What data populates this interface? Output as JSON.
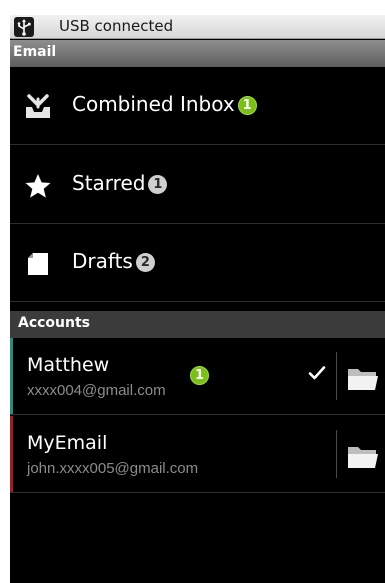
{
  "status_bar": {
    "notification_icon": "usb-icon",
    "text": "USB connected"
  },
  "title_bar": {
    "title": "Email"
  },
  "mailboxes": [
    {
      "label": "Combined Inbox",
      "icon": "inbox-icon",
      "badge": "1",
      "badge_color": "#7cbf1a"
    },
    {
      "label": "Starred",
      "icon": "star-icon",
      "badge": "1",
      "badge_color": "#cfcfcf"
    },
    {
      "label": "Drafts",
      "icon": "draft-icon",
      "badge": "2",
      "badge_color": "#cfcfcf"
    }
  ],
  "accounts_section": {
    "title": "Accounts"
  },
  "accounts": [
    {
      "name": "Matthew",
      "email": "xxxx004@gmail.com",
      "badge": "1",
      "selected": true,
      "color": "#2a8a7c",
      "folder_icon": "folder-icon"
    },
    {
      "name": "MyEmail",
      "email": "john.xxxx005@gmail.com",
      "badge": "",
      "selected": false,
      "color": "#9c1d22",
      "folder_icon": "folder-icon"
    }
  ]
}
